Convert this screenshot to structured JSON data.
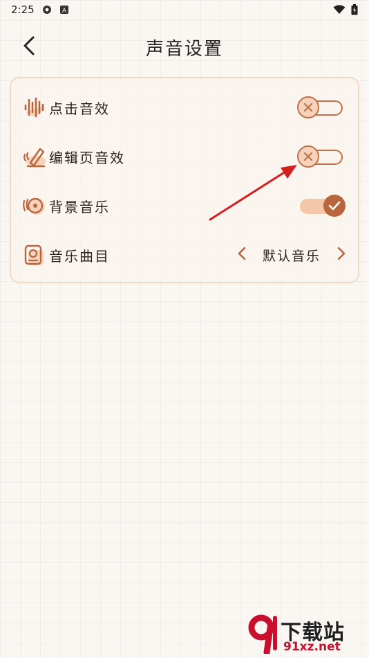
{
  "status_bar": {
    "time": "2:25",
    "icons_left": [
      "settings-icon",
      "font-icon"
    ],
    "icons_right": [
      "wifi-icon",
      "battery-icon"
    ]
  },
  "header": {
    "title": "声音设置",
    "back_icon": "chevron-left-icon"
  },
  "settings": {
    "click_sound": {
      "label": "点击音效",
      "icon": "sound-wave-icon",
      "enabled": false
    },
    "edit_sound": {
      "label": "编辑页音效",
      "icon": "pen-icon",
      "enabled": false
    },
    "bg_music": {
      "label": "背景音乐",
      "icon": "music-disc-icon",
      "enabled": true
    },
    "music_track": {
      "label": "音乐曲目",
      "icon": "music-player-icon",
      "selected": "默认音乐",
      "prev_icon": "chevron-left-icon",
      "next_icon": "chevron-right-icon"
    }
  },
  "watermark": {
    "text_main": "下载站",
    "text_site": "91xz.net"
  },
  "colors": {
    "accent": "#b8663d",
    "accent_light": "#f3c7a7",
    "card_border": "#f3d9c2",
    "annotation_arrow": "#d41f1f"
  }
}
